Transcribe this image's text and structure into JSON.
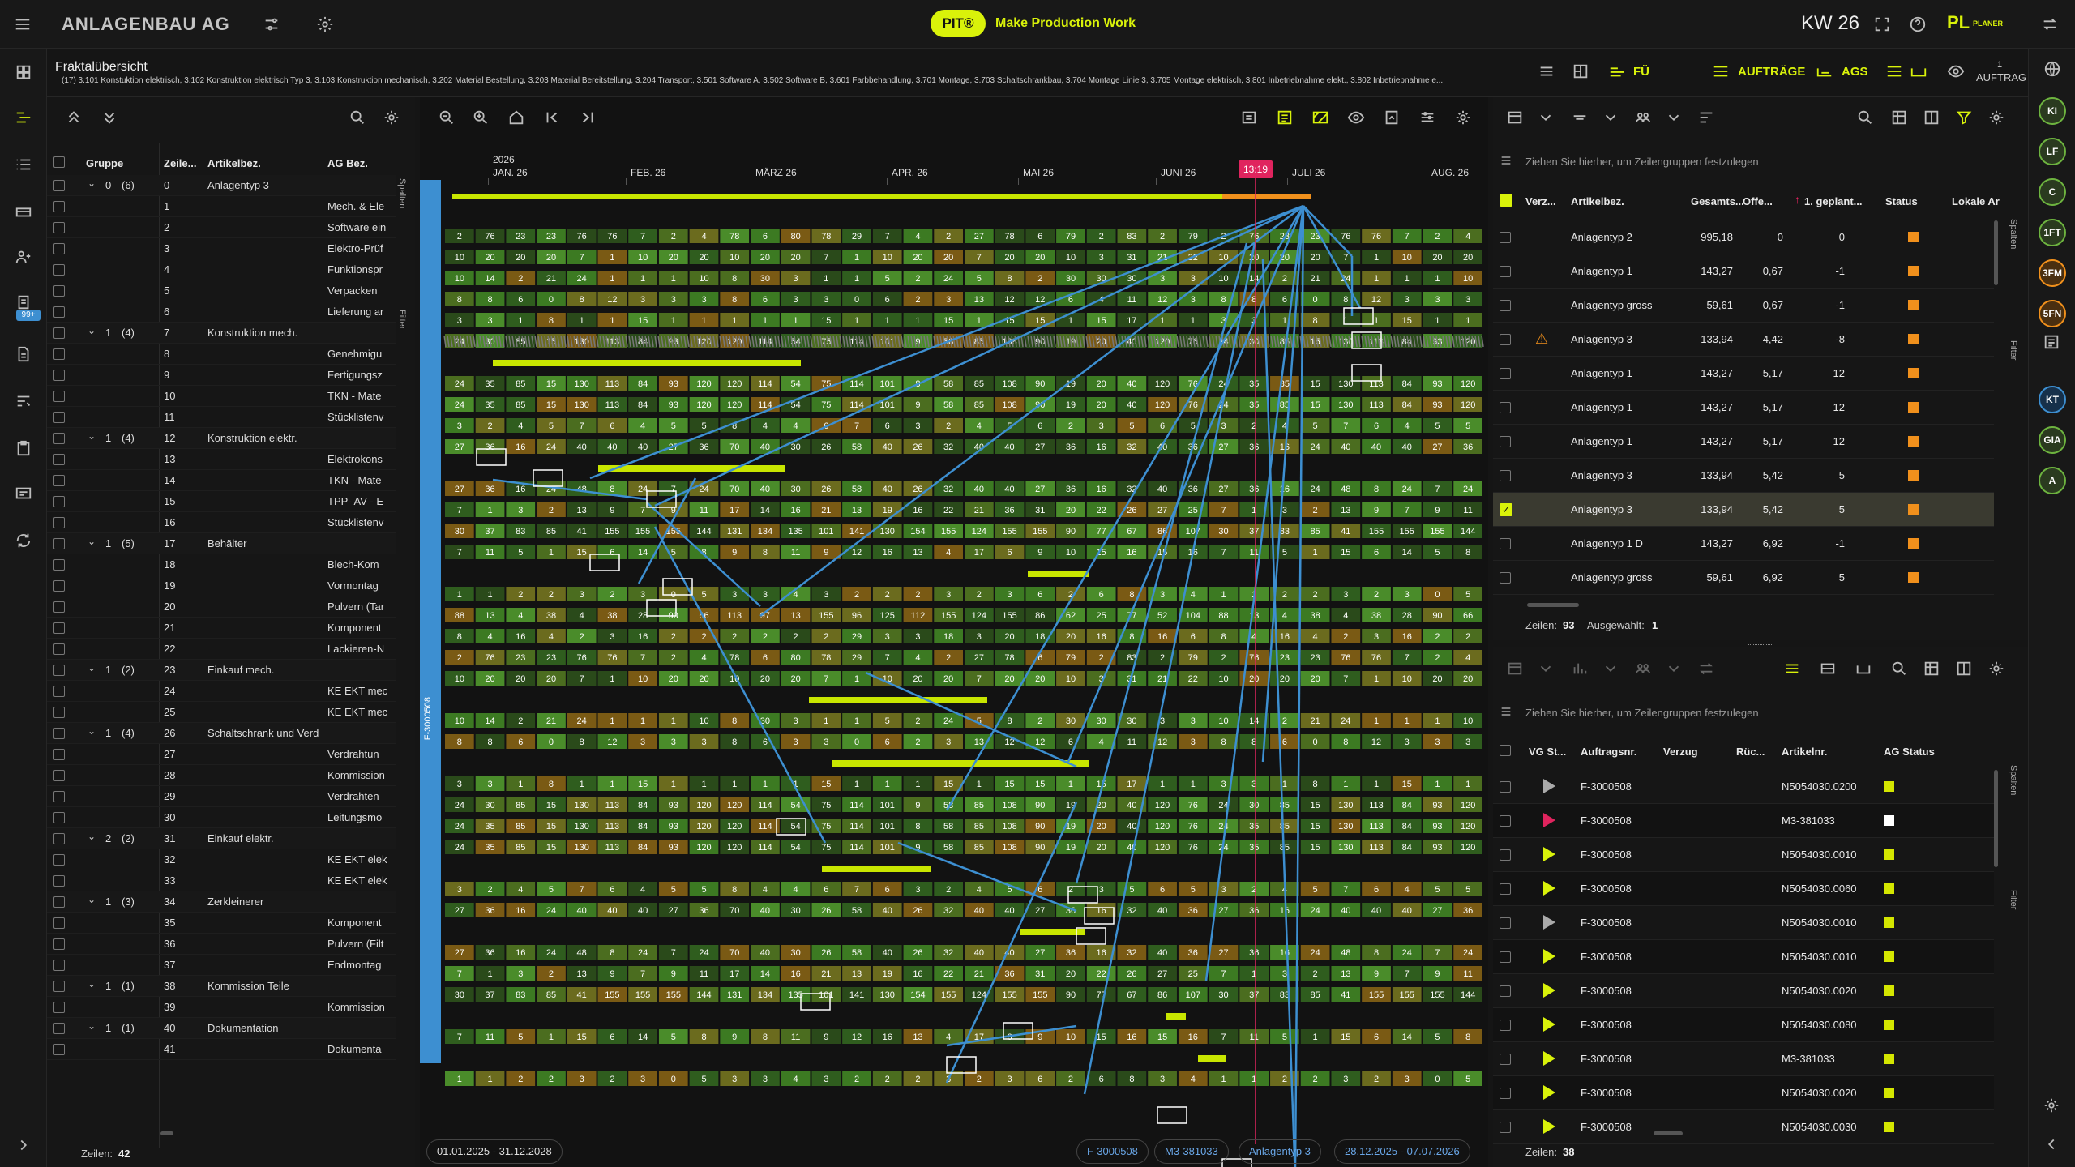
{
  "app": {
    "title": "ANLAGENBAU AG",
    "brand_badge": "PIT®",
    "tagline": "Make Production Work",
    "week": "KW 26",
    "pl": "PL",
    "pl_sub": "PLANER"
  },
  "subheader": {
    "title": "Fraktalübersicht",
    "path": "(17) 3.101 Konstuktion elektrisch, 3.102 Konstruktion elektrisch Typ 3, 3.103 Konstruktion mechanisch, 3.202 Material Bestellung, 3.203 Material Bereitstellung, 3.204 Transport, 3.501 Software A, 3.502 Software B, 3.601 Farbbehandlung, 3.701 Montage, 3.703 Schaltschrankbau, 3.704 Montage Linie 3, 3.705 Montage elektrisch, 3.801 Inbetriebnahme elekt., 3.802 Inbetriebnahme e...",
    "fu": "FÜ",
    "auftraege": "AUFTRÄGE",
    "ags": "AGS",
    "auftrag_count": "1",
    "auftrag": "AUFTRAG"
  },
  "left": {
    "headers": [
      "Gruppe",
      "Zeile...",
      "Artikelbez.",
      "AG Bez."
    ],
    "footer_label": "Zeilen:",
    "footer_count": "42",
    "side_tabs": [
      "Spalten",
      "Filter"
    ],
    "rows": [
      {
        "g": "0",
        "c": "(6)",
        "z": "0",
        "a": "Anlagentyp 3",
        "b": ""
      },
      {
        "g": "",
        "c": "",
        "z": "1",
        "a": "",
        "b": "Mech. & Ele"
      },
      {
        "g": "",
        "c": "",
        "z": "2",
        "a": "",
        "b": "Software ein"
      },
      {
        "g": "",
        "c": "",
        "z": "3",
        "a": "",
        "b": "Elektro-Prüf"
      },
      {
        "g": "",
        "c": "",
        "z": "4",
        "a": "",
        "b": "Funktionspr"
      },
      {
        "g": "",
        "c": "",
        "z": "5",
        "a": "",
        "b": "Verpacken"
      },
      {
        "g": "",
        "c": "",
        "z": "6",
        "a": "",
        "b": "Lieferung ar"
      },
      {
        "g": "1",
        "c": "(4)",
        "z": "7",
        "a": "Konstruktion mech.",
        "b": ""
      },
      {
        "g": "",
        "c": "",
        "z": "8",
        "a": "",
        "b": "Genehmigu"
      },
      {
        "g": "",
        "c": "",
        "z": "9",
        "a": "",
        "b": "Fertigungsz"
      },
      {
        "g": "",
        "c": "",
        "z": "10",
        "a": "",
        "b": "TKN - Mate"
      },
      {
        "g": "",
        "c": "",
        "z": "11",
        "a": "",
        "b": "Stücklistenv"
      },
      {
        "g": "1",
        "c": "(4)",
        "z": "12",
        "a": "Konstruktion elektr.",
        "b": ""
      },
      {
        "g": "",
        "c": "",
        "z": "13",
        "a": "",
        "b": "Elektrokons"
      },
      {
        "g": "",
        "c": "",
        "z": "14",
        "a": "",
        "b": "TKN - Mate"
      },
      {
        "g": "",
        "c": "",
        "z": "15",
        "a": "",
        "b": "TPP- AV - E"
      },
      {
        "g": "",
        "c": "",
        "z": "16",
        "a": "",
        "b": "Stücklistenv"
      },
      {
        "g": "1",
        "c": "(5)",
        "z": "17",
        "a": "Behälter",
        "b": ""
      },
      {
        "g": "",
        "c": "",
        "z": "18",
        "a": "",
        "b": "Blech-Kom"
      },
      {
        "g": "",
        "c": "",
        "z": "19",
        "a": "",
        "b": "Vormontag"
      },
      {
        "g": "",
        "c": "",
        "z": "20",
        "a": "",
        "b": "Pulvern (Tar"
      },
      {
        "g": "",
        "c": "",
        "z": "21",
        "a": "",
        "b": "Komponent"
      },
      {
        "g": "",
        "c": "",
        "z": "22",
        "a": "",
        "b": "Lackieren-N"
      },
      {
        "g": "1",
        "c": "(2)",
        "z": "23",
        "a": "Einkauf mech.",
        "b": ""
      },
      {
        "g": "",
        "c": "",
        "z": "24",
        "a": "",
        "b": "KE EKT mec"
      },
      {
        "g": "",
        "c": "",
        "z": "25",
        "a": "",
        "b": "KE EKT mec"
      },
      {
        "g": "1",
        "c": "(4)",
        "z": "26",
        "a": "Schaltschrank und Verd",
        "b": ""
      },
      {
        "g": "",
        "c": "",
        "z": "27",
        "a": "",
        "b": "Verdrahtun"
      },
      {
        "g": "",
        "c": "",
        "z": "28",
        "a": "",
        "b": "Kommission"
      },
      {
        "g": "",
        "c": "",
        "z": "29",
        "a": "",
        "b": "Verdrahten"
      },
      {
        "g": "",
        "c": "",
        "z": "30",
        "a": "",
        "b": "Leitungsmo"
      },
      {
        "g": "2",
        "c": "(2)",
        "z": "31",
        "a": "Einkauf elektr.",
        "b": ""
      },
      {
        "g": "",
        "c": "",
        "z": "32",
        "a": "",
        "b": "KE EKT elek"
      },
      {
        "g": "",
        "c": "",
        "z": "33",
        "a": "",
        "b": "KE EKT elek"
      },
      {
        "g": "1",
        "c": "(3)",
        "z": "34",
        "a": "Zerkleinerer",
        "b": ""
      },
      {
        "g": "",
        "c": "",
        "z": "35",
        "a": "",
        "b": "Komponent"
      },
      {
        "g": "",
        "c": "",
        "z": "36",
        "a": "",
        "b": "Pulvern (Filt"
      },
      {
        "g": "",
        "c": "",
        "z": "37",
        "a": "",
        "b": "Endmontag"
      },
      {
        "g": "1",
        "c": "(1)",
        "z": "38",
        "a": "Kommission Teile",
        "b": ""
      },
      {
        "g": "",
        "c": "",
        "z": "39",
        "a": "",
        "b": "Kommission"
      },
      {
        "g": "1",
        "c": "(1)",
        "z": "40",
        "a": "Dokumentation",
        "b": ""
      },
      {
        "g": "",
        "c": "",
        "z": "41",
        "a": "",
        "b": "Dokumenta"
      }
    ]
  },
  "gantt": {
    "year": "2026",
    "months": [
      "JAN. 26",
      "FEB. 26",
      "MÄRZ 26",
      "APR. 26",
      "MAI 26",
      "JUNI 26",
      "JULI 26",
      "AUG. 26"
    ],
    "now": "13:19",
    "side_label": "F-3000508",
    "date_range": "01.01.2025 - 31.12.2028",
    "chips": [
      "F-3000508",
      "M3-381033",
      "Anlagentyp 3",
      "28.12.2025 - 07.07.2026"
    ],
    "rowvals": [
      [
        "2",
        "76",
        "23",
        "23",
        "76",
        "76",
        "7",
        "2",
        "4",
        "78",
        "6",
        "80",
        "78",
        "29",
        "7",
        "4",
        "2",
        "27",
        "78",
        "6",
        "79",
        "2",
        "83",
        "2",
        "79"
      ],
      [
        "10",
        "20",
        "20",
        "20",
        "7",
        "1",
        "10",
        "20",
        "20",
        "10",
        "20",
        "20",
        "7",
        "1",
        "10",
        "20",
        "20",
        "7",
        "20",
        "20",
        "10",
        "3",
        "31",
        "21",
        "22"
      ],
      [
        "10",
        "14",
        "2",
        "21",
        "24",
        "1",
        "1",
        "1",
        "10",
        "8",
        "30",
        "3",
        "1",
        "1",
        "5",
        "2",
        "24",
        "5",
        "8",
        "2",
        "30",
        "30",
        "30",
        "3",
        "3"
      ],
      [
        "8",
        "8",
        "6",
        "0",
        "8",
        "12",
        "3",
        "3",
        "3",
        "8",
        "6",
        "3",
        "3",
        "0",
        "6",
        "2",
        "3",
        "13",
        "12",
        "12",
        "6",
        "4",
        "11",
        "12",
        "3"
      ],
      [
        "3",
        "3",
        "1",
        "8",
        "1",
        "1",
        "15",
        "1",
        "1",
        "1",
        "1",
        "1",
        "15",
        "1",
        "1",
        "1",
        "15",
        "1",
        "15",
        "15",
        "1",
        "15",
        "17",
        "1",
        "1"
      ],
      [
        "24",
        "30",
        "85",
        "15",
        "130",
        "113",
        "84",
        "93",
        "120",
        "120",
        "114",
        "54",
        "75",
        "114",
        "101",
        "9",
        "58",
        "85",
        "108",
        "90",
        "19",
        "20",
        "40",
        "120",
        "76"
      ],
      [
        "24",
        "35",
        "85",
        "15",
        "130",
        "113",
        "84",
        "93",
        "120",
        "120",
        "114",
        "54",
        "75",
        "114",
        "101",
        "8",
        "58",
        "85",
        "108",
        "90",
        "19",
        "20",
        "40",
        "120",
        "76"
      ],
      [
        "24",
        "35",
        "85",
        "15",
        "130",
        "113",
        "84",
        "93",
        "120",
        "120",
        "114",
        "54",
        "75",
        "114",
        "101",
        "9",
        "58",
        "85",
        "108",
        "90",
        "19",
        "20",
        "40",
        "120",
        "76"
      ],
      [
        "3",
        "2",
        "4",
        "5",
        "7",
        "6",
        "4",
        "5",
        "5",
        "8",
        "4",
        "4",
        "6",
        "7",
        "6",
        "3",
        "2",
        "4",
        "5",
        "6",
        "2",
        "3",
        "5",
        "6",
        "5"
      ],
      [
        "27",
        "36",
        "16",
        "24",
        "40",
        "40",
        "40",
        "27",
        "36",
        "70",
        "40",
        "30",
        "26",
        "58",
        "40",
        "26",
        "32",
        "40",
        "40",
        "27",
        "36",
        "16",
        "32",
        "40",
        "36"
      ],
      [
        "27",
        "36",
        "16",
        "24",
        "48",
        "8",
        "24",
        "7",
        "24",
        "70",
        "40",
        "30",
        "26",
        "58",
        "40",
        "26",
        "32",
        "40",
        "40",
        "27",
        "36",
        "16",
        "32",
        "40",
        "36"
      ],
      [
        "7",
        "1",
        "3",
        "2",
        "13",
        "9",
        "7",
        "9",
        "11",
        "17",
        "14",
        "16",
        "21",
        "13",
        "19",
        "16",
        "22",
        "21",
        "36",
        "31",
        "20",
        "22",
        "26",
        "27",
        "25"
      ],
      [
        "30",
        "37",
        "83",
        "85",
        "41",
        "155",
        "155",
        "155",
        "144",
        "131",
        "134",
        "135",
        "101",
        "141",
        "130",
        "154",
        "155",
        "124",
        "155",
        "155",
        "90",
        "77",
        "67",
        "86",
        "107"
      ],
      [
        "7",
        "11",
        "5",
        "1",
        "15",
        "6",
        "14",
        "5",
        "8",
        "9",
        "8",
        "11",
        "9",
        "12",
        "16",
        "13",
        "4",
        "17",
        "6",
        "9",
        "10",
        "15",
        "16",
        "15",
        "16"
      ],
      [
        "1",
        "1",
        "2",
        "2",
        "3",
        "2",
        "3",
        "0",
        "5",
        "3",
        "3",
        "4",
        "3",
        "2",
        "2",
        "2",
        "3",
        "2",
        "3",
        "6",
        "2",
        "6",
        "8",
        "3",
        "4"
      ],
      [
        "88",
        "13",
        "4",
        "38",
        "4",
        "38",
        "28",
        "90",
        "66",
        "113",
        "97",
        "13",
        "155",
        "96",
        "125",
        "112",
        "155",
        "124",
        "155",
        "86",
        "62",
        "25",
        "77",
        "52",
        "104"
      ],
      [
        "8",
        "4",
        "16",
        "4",
        "2",
        "3",
        "16",
        "2",
        "2",
        "2",
        "2",
        "2",
        "2",
        "29",
        "3",
        "3",
        "18",
        "3",
        "20",
        "18",
        "20",
        "16",
        "8",
        "16",
        "6"
      ]
    ]
  },
  "right_top": {
    "group_hint": "Ziehen Sie hierher, um Zeilengruppen festzulegen",
    "headers": [
      "Verz...",
      "Artikelbez.",
      "Gesamts...",
      "Offe...",
      "1. geplant...",
      "Status",
      "Lokale Ar"
    ],
    "rows": [
      {
        "a": "Anlagentyp 2",
        "g": "995,18",
        "o": "0",
        "p": "0",
        "warn": false,
        "checked": false
      },
      {
        "a": "Anlagentyp 1",
        "g": "143,27",
        "o": "0,67",
        "p": "-1",
        "warn": false,
        "checked": false
      },
      {
        "a": "Anlagentyp gross",
        "g": "59,61",
        "o": "0,67",
        "p": "-1",
        "warn": false,
        "checked": false
      },
      {
        "a": "Anlagentyp 3",
        "g": "133,94",
        "o": "4,42",
        "p": "-8",
        "warn": true,
        "checked": false
      },
      {
        "a": "Anlagentyp 1",
        "g": "143,27",
        "o": "5,17",
        "p": "12",
        "warn": false,
        "checked": false
      },
      {
        "a": "Anlagentyp 1",
        "g": "143,27",
        "o": "5,17",
        "p": "12",
        "warn": false,
        "checked": false
      },
      {
        "a": "Anlagentyp 1",
        "g": "143,27",
        "o": "5,17",
        "p": "12",
        "warn": false,
        "checked": false
      },
      {
        "a": "Anlagentyp 3",
        "g": "133,94",
        "o": "5,42",
        "p": "5",
        "warn": false,
        "checked": false
      },
      {
        "a": "Anlagentyp 3",
        "g": "133,94",
        "o": "5,42",
        "p": "5",
        "warn": false,
        "checked": true
      },
      {
        "a": "Anlagentyp 1 D",
        "g": "143,27",
        "o": "6,92",
        "p": "-1",
        "warn": false,
        "checked": false
      },
      {
        "a": "Anlagentyp gross",
        "g": "59,61",
        "o": "6,92",
        "p": "5",
        "warn": false,
        "checked": false
      }
    ],
    "footer_rows_label": "Zeilen:",
    "footer_rows": "93",
    "footer_sel_label": "Ausgewählt:",
    "footer_sel": "1",
    "side_tabs": [
      "Spalten",
      "Filter"
    ]
  },
  "right_bottom": {
    "group_hint": "Ziehen Sie hierher, um Zeilengruppen festzulegen",
    "headers": [
      "VG St...",
      "Auftragsnr.",
      "Verzug",
      "Rüc...",
      "Artikelnr.",
      "AG Status"
    ],
    "rows": [
      {
        "play": "grey",
        "auf": "F-3000508",
        "art": "N5054030.0200",
        "st": "#d4e600"
      },
      {
        "play": "red",
        "auf": "F-3000508",
        "art": "M3-381033",
        "st": "#ffffff"
      },
      {
        "play": "yellow",
        "auf": "F-3000508",
        "art": "N5054030.0010",
        "st": "#d4e600"
      },
      {
        "play": "yellow",
        "auf": "F-3000508",
        "art": "N5054030.0060",
        "st": "#d4e600"
      },
      {
        "play": "grey",
        "auf": "F-3000508",
        "art": "N5054030.0010",
        "st": "#d4e600"
      },
      {
        "play": "yellow",
        "auf": "F-3000508",
        "art": "N5054030.0010",
        "st": "#d4e600"
      },
      {
        "play": "yellow",
        "auf": "F-3000508",
        "art": "N5054030.0020",
        "st": "#d4e600"
      },
      {
        "play": "yellow",
        "auf": "F-3000508",
        "art": "N5054030.0080",
        "st": "#d4e600"
      },
      {
        "play": "yellow",
        "auf": "F-3000508",
        "art": "M3-381033",
        "st": "#d4e600"
      },
      {
        "play": "yellow",
        "auf": "F-3000508",
        "art": "N5054030.0020",
        "st": "#d4e600"
      },
      {
        "play": "yellow",
        "auf": "F-3000508",
        "art": "N5054030.0030",
        "st": "#d4e600"
      }
    ],
    "footer_rows_label": "Zeilen:",
    "footer_rows": "38",
    "side_tabs": [
      "Spalten",
      "Filter"
    ]
  },
  "avatars": [
    "KI",
    "LF",
    "C",
    "1FT",
    "3FM",
    "5FN",
    "KT",
    "GIA",
    "A"
  ],
  "colors": {
    "accent": "#c8e600",
    "orange": "#f0901c",
    "blue": "#3d8fd1",
    "now_line": "#e0245e"
  }
}
